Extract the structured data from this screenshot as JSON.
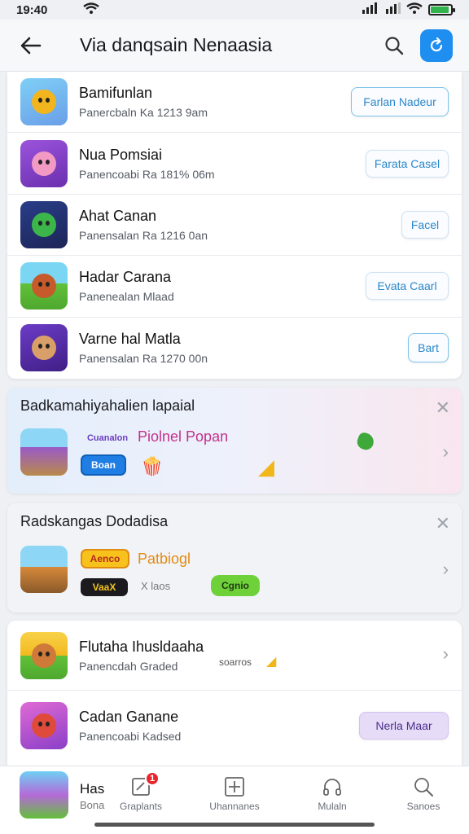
{
  "status_bar": {
    "time": "19:40"
  },
  "header": {
    "title": "Via danqsain Nenaasia"
  },
  "apps": [
    {
      "title": "Bamifunlan",
      "subtitle": "Panercbaln Ka 1213 9am",
      "action": "Farlan Nadeur",
      "active": true,
      "icon_bg": "#6fc4f0",
      "icon_face": "#f2b51e"
    },
    {
      "title": "Nua Pomsiai",
      "subtitle": "Panencoabi Ra 181% 06m",
      "action": "Farata Casel",
      "active": false,
      "icon_bg": "#7a3fc4",
      "icon_face": "#f29ac4"
    },
    {
      "title": "Ahat Canan",
      "subtitle": "Panensalan Ra 1216 0an",
      "action": "Facel",
      "active": false,
      "icon_bg": "#2b3f7d",
      "icon_face": "#3cb54a"
    },
    {
      "title": "Hadar Carana",
      "subtitle": "Panenealan Mlaad",
      "action": "Evata Caarl",
      "active": false,
      "icon_bg": "#6cc23a",
      "icon_face": "#c65a2a"
    },
    {
      "title": "Varne hal Matla",
      "subtitle": "Panensalan Ra 1270 00n",
      "action": "Bart",
      "active": true,
      "icon_bg": "#5a2fa8",
      "icon_face": "#d8a068"
    }
  ],
  "promo_1": {
    "title": "Badkamahiyahalien lapaial",
    "highlight": "Piolnel Popan",
    "tag_label": "Boan",
    "tag_top_label": "Cuanalon"
  },
  "promo_2": {
    "title": "Radskangas Dodadisa",
    "highlight": "Patbiogl",
    "tag_1": "Aenco",
    "tag_2": "VaaX",
    "small_label": "X laos",
    "green_tag": "Cgnio"
  },
  "lower_apps": [
    {
      "title": "Flutaha Ihusldaaha",
      "subtitle": "Panencdah Graded",
      "extra": "soarros"
    },
    {
      "title": "Cadan Ganane",
      "subtitle": "Panencoabi Kadsed",
      "action": "Nerla Maar"
    }
  ],
  "bottom_nav": {
    "app_label": "Has",
    "app_sub": "Bona",
    "badge": "1",
    "items": [
      {
        "label": "Graplants",
        "icon": "note-icon"
      },
      {
        "label": "Uhannanes",
        "icon": "grid-icon"
      },
      {
        "label": "Mulaln",
        "icon": "headphones-icon"
      },
      {
        "label": "Sanoes",
        "icon": "search-icon"
      }
    ]
  },
  "colors": {
    "accent": "#1e8ef0",
    "badge": "#e8262e",
    "green": "#6fd13a",
    "magenta": "#c4318a",
    "orange": "#e28b14"
  }
}
